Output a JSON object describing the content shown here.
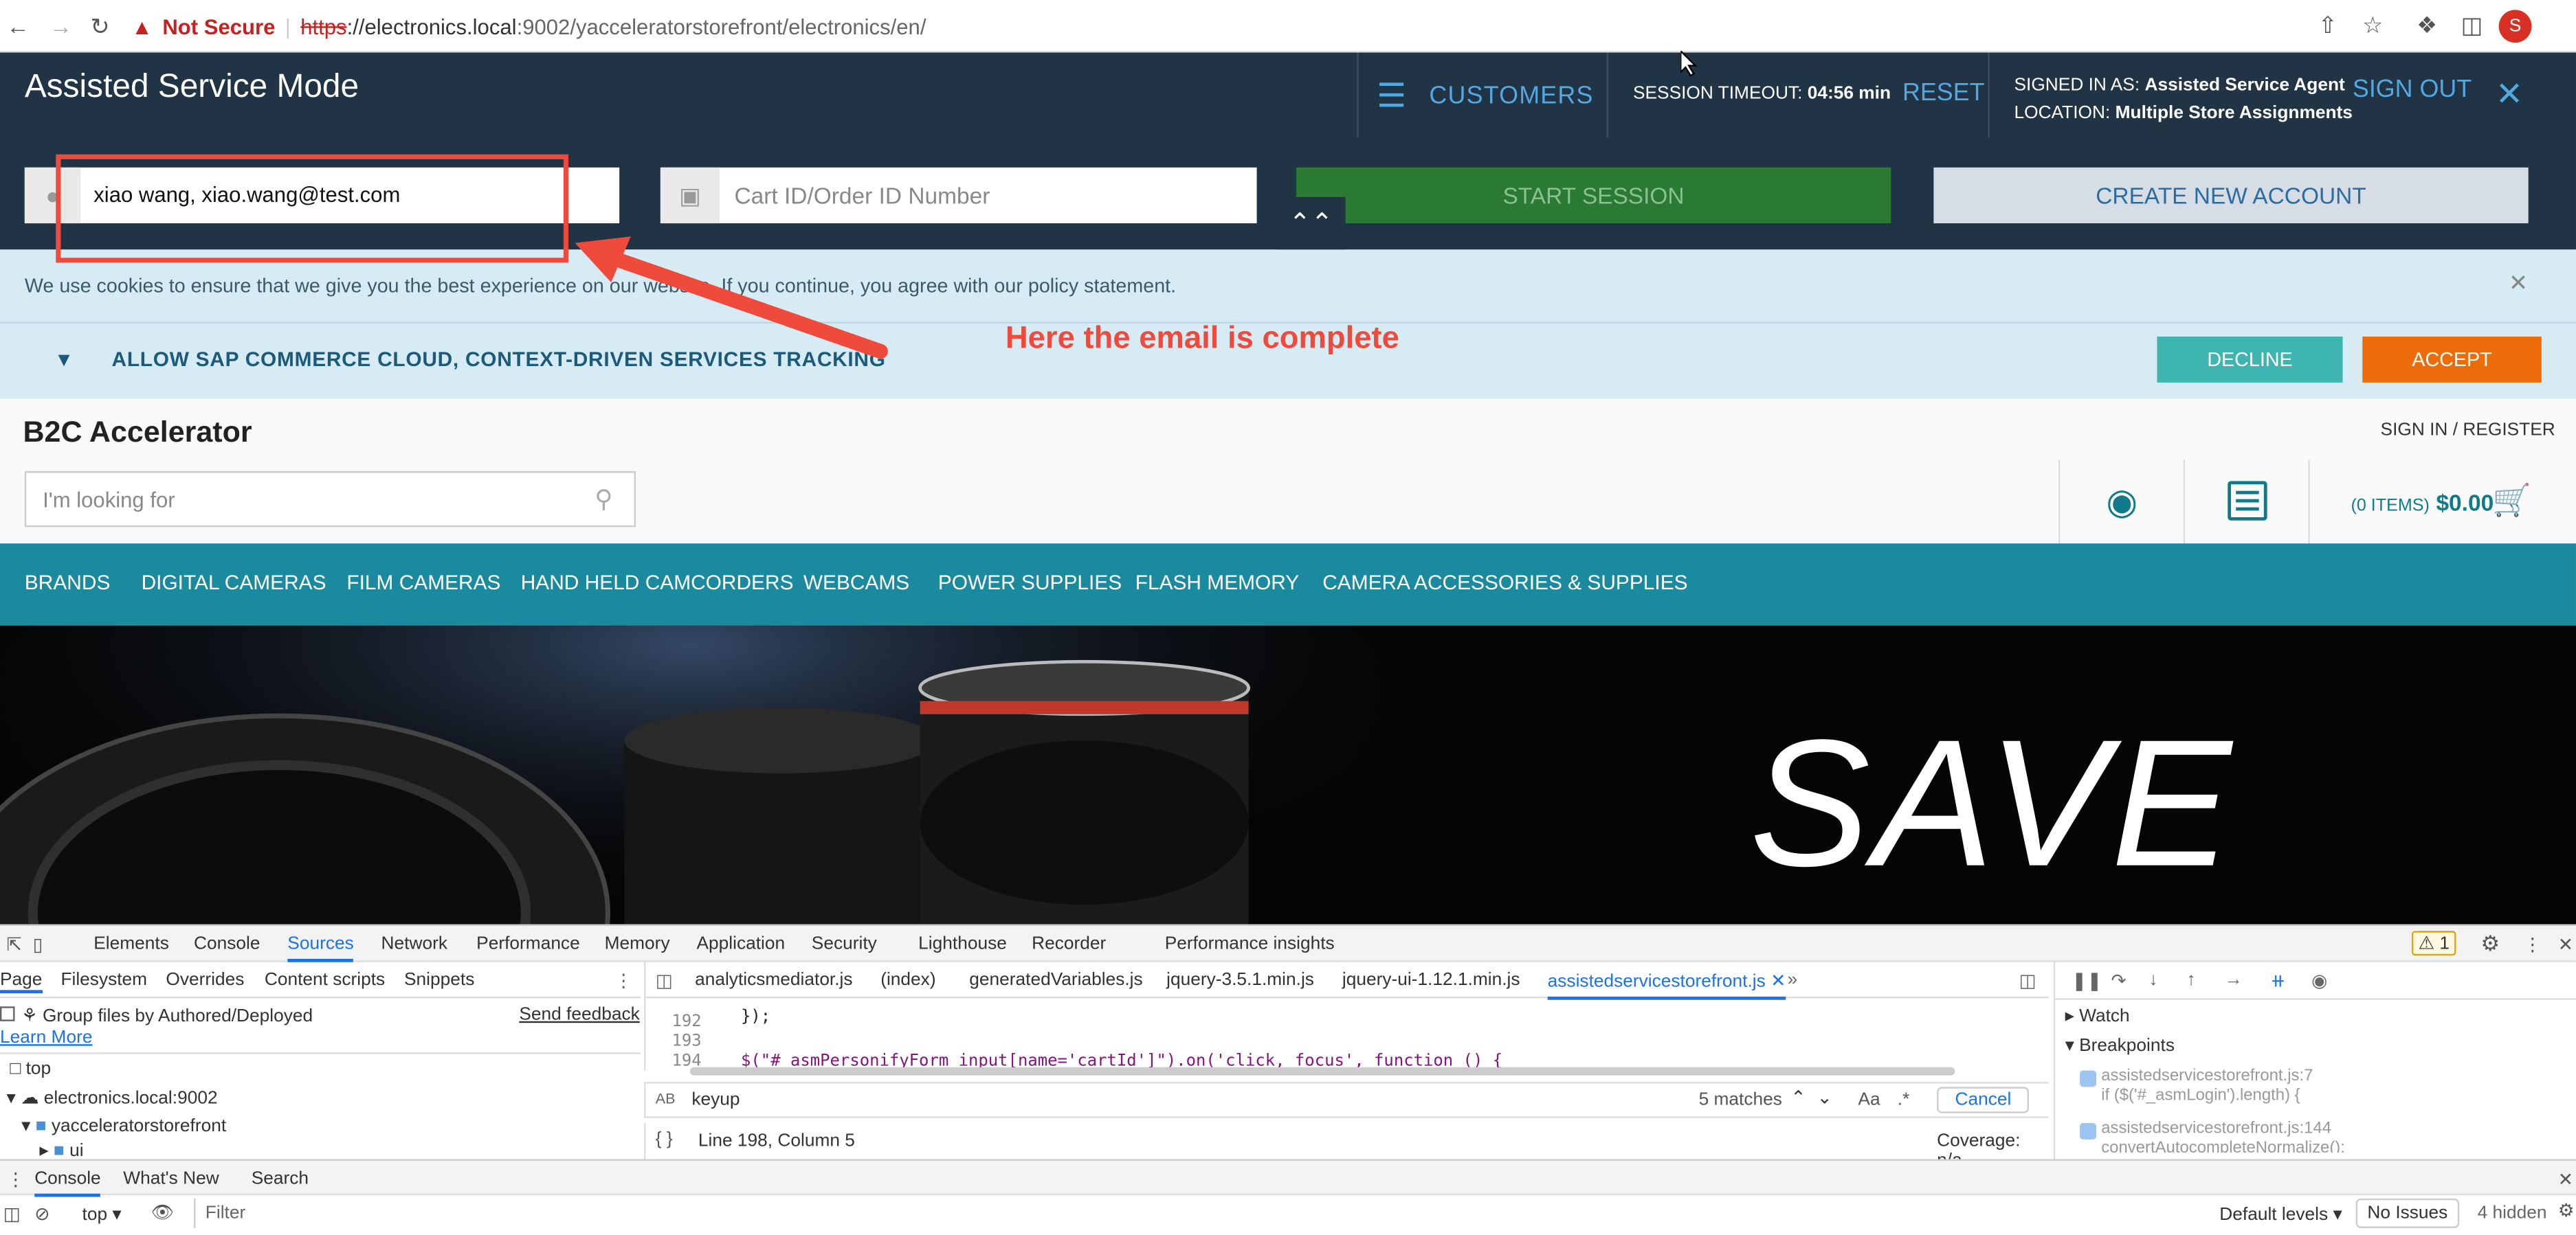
{
  "browser": {
    "warning": "Not Secure",
    "url_scheme": "https",
    "url_host": "://electronics.local",
    "url_rest": ":9002/yacceleratorstorefront/electronics/en/",
    "profile_initial": "S"
  },
  "asm": {
    "title": "Assisted Service Mode",
    "customers_label": "CUSTOMERS",
    "timeout_label": "SESSION TIMEOUT:",
    "timeout_value": "04:56 min",
    "reset_label": "RESET",
    "signed_in_label": "SIGNED IN AS:",
    "signed_in_value": "Assisted Service Agent",
    "location_label": "LOCATION:",
    "location_value": "Multiple Store Assignments",
    "sign_out_label": "SIGN OUT",
    "customer_field_value": "xiao wang, xiao.wang@test.com",
    "cart_placeholder": "Cart ID/Order ID Number",
    "start_session_label": "START SESSION",
    "create_account_label": "CREATE NEW ACCOUNT"
  },
  "annotation": {
    "text": "Here the email is complete",
    "color": "#ee4b3c"
  },
  "cookie": {
    "text": "We use cookies to ensure that we give you the best experience on our website. If you continue, you agree with our policy statement.",
    "tracking_label": "ALLOW SAP COMMERCE CLOUD, CONTEXT-DRIVEN SERVICES TRACKING",
    "decline_label": "DECLINE",
    "accept_label": "ACCEPT"
  },
  "header": {
    "brand": "B2C Accelerator",
    "sign_in_label": "SIGN IN / REGISTER",
    "search_placeholder": "I'm looking for",
    "cart_items": "(0 ITEMS)",
    "cart_total": "$0.00"
  },
  "categories": [
    "BRANDS",
    "DIGITAL CAMERAS",
    "FILM CAMERAS",
    "HAND HELD CAMCORDERS",
    "WEBCAMS",
    "POWER SUPPLIES",
    "FLASH MEMORY",
    "CAMERA ACCESSORIES & SUPPLIES"
  ],
  "hero": {
    "headline": "SAVE"
  },
  "devtools": {
    "main_tabs": [
      "Elements",
      "Console",
      "Sources",
      "Network",
      "Performance",
      "Memory",
      "Application",
      "Security",
      "Lighthouse",
      "Recorder",
      "Performance insights"
    ],
    "issue_count": "1",
    "nav_tabs": [
      "Page",
      "Filesystem",
      "Overrides",
      "Content scripts",
      "Snippets"
    ],
    "group_files_label": "Group files by Authored/Deployed",
    "send_feedback": "Send feedback",
    "learn_more": "Learn More",
    "tree": [
      "top",
      "electronics.local:9002",
      "yacceleratorstorefront",
      "ui"
    ],
    "file_tabs": [
      "analyticsmediator.js",
      "(index)",
      "generatedVariables.js",
      "jquery-3.5.1.min.js",
      "jquery-ui-1.12.1.min.js",
      "assistedservicestorefront.js"
    ],
    "code_lines": [
      {
        "num": "192",
        "code": "});"
      },
      {
        "num": "193",
        "code": ""
      },
      {
        "num": "194",
        "code": "$(\"# asmPersonifyForm input[name='cartId']\").on('click, focus', function () {"
      }
    ],
    "search_query": "keyup",
    "matches": "5 matches",
    "case_label": "Aa",
    "regex_label": ".*",
    "cancel_label": "Cancel",
    "status_position": "Line 198, Column 5",
    "coverage": "Coverage: n/a",
    "watch_label": "Watch",
    "breakpoints_label": "Breakpoints",
    "breakpoints": [
      {
        "file": "assistedservicestorefront.js:7",
        "code": "if ($('#_asmLogin').length) {"
      },
      {
        "file": "assistedservicestorefront.js:144",
        "code": "convertAutocompleteNormalize();"
      }
    ],
    "drawer_tabs": [
      "Console",
      "What's New",
      "Search"
    ],
    "context": "top",
    "filter_placeholder": "Filter",
    "default_levels": "Default levels",
    "no_issues": "No Issues",
    "hidden": "4 hidden"
  }
}
